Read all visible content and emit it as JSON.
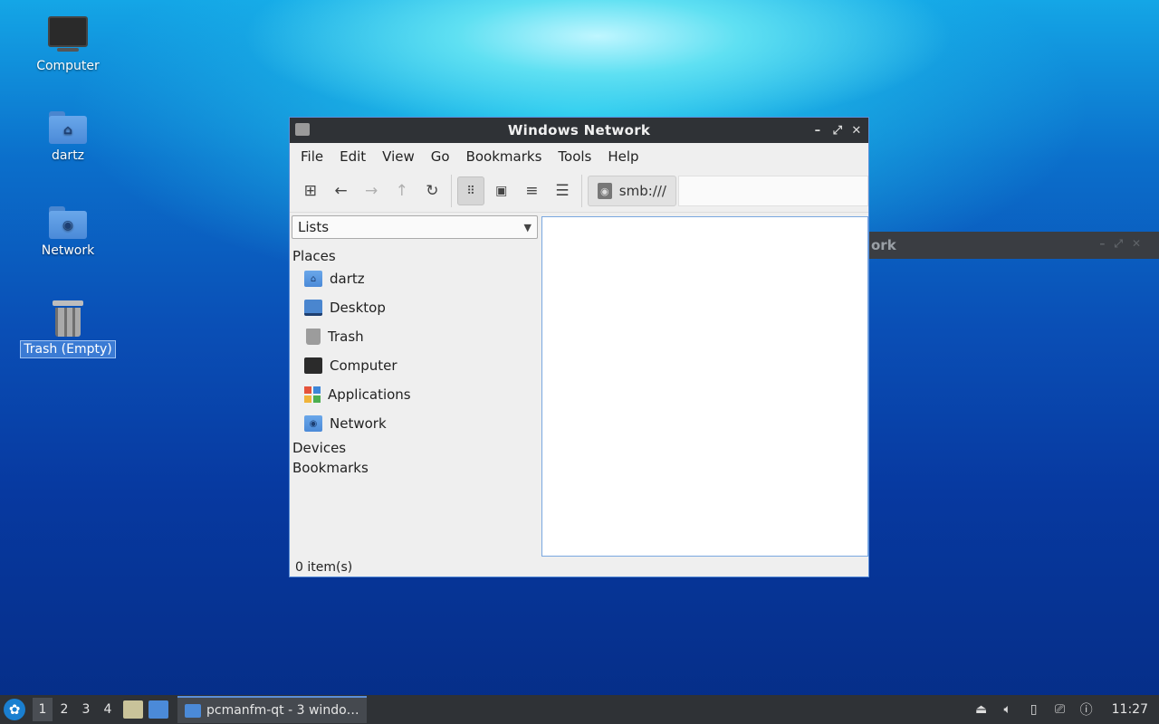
{
  "desktop": {
    "icons": [
      {
        "label": "Computer"
      },
      {
        "label": "dartz"
      },
      {
        "label": "Network"
      },
      {
        "label": "Trash (Empty)"
      }
    ]
  },
  "background_window": {
    "title_fragment": "ork"
  },
  "window": {
    "title": "Windows Network",
    "menu": [
      "File",
      "Edit",
      "View",
      "Go",
      "Bookmarks",
      "Tools",
      "Help"
    ],
    "path": "smb:///",
    "side_pane": {
      "mode": "Lists",
      "sections": {
        "places": "Places",
        "devices": "Devices",
        "bookmarks": "Bookmarks"
      },
      "places": [
        "dartz",
        "Desktop",
        "Trash",
        "Computer",
        "Applications",
        "Network"
      ]
    },
    "status": "0 item(s)"
  },
  "taskbar": {
    "workspaces": [
      "1",
      "2",
      "3",
      "4"
    ],
    "task_label": "pcmanfm-qt - 3 windo…",
    "clock": "11:27"
  },
  "colors": {
    "accent": "#5b8fd9",
    "titlebar": "#2f3236",
    "folder": "#4b8ad8"
  }
}
